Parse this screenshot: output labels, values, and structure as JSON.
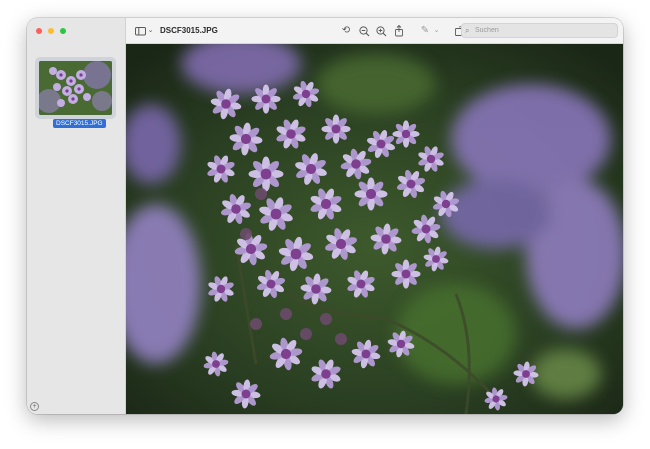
{
  "window": {
    "title": "DSCF3015.JPG"
  },
  "sidebar": {
    "thumbnails": [
      {
        "label": "DSCF3015.JPG",
        "selected": true
      }
    ]
  },
  "toolbar": {
    "search_placeholder": "Suchen"
  },
  "image": {
    "subject": "purple flower clusters",
    "palette": {
      "petal": "#b39bd6",
      "petal_light": "#d6c6ee",
      "center": "#7d3f8e",
      "foliage": "#3f6a2e",
      "background": "#1f2c1c"
    }
  },
  "colors": {
    "accent": "#2f6fd6",
    "close": "#ff5f57",
    "minimize": "#febc2e",
    "zoom": "#28c840"
  }
}
